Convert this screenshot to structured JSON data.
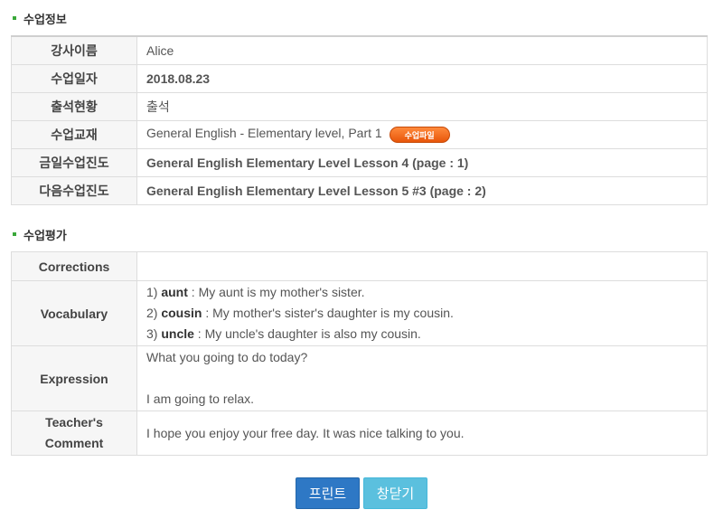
{
  "class_info": {
    "section_title": "수업정보",
    "rows": [
      {
        "label": "강사이름",
        "value": "Alice"
      },
      {
        "label": "수업일자",
        "value": "2018.08.23"
      },
      {
        "label": "출석현황",
        "value": "출석"
      },
      {
        "label": "수업교재",
        "value": "General English - Elementary level, Part 1",
        "button": "수업파일"
      },
      {
        "label": "금일수업진도",
        "value": "General English Elementary Level Lesson 4 (page : 1)"
      },
      {
        "label": "다음수업진도",
        "value": "General English Elementary Level Lesson 5 #3 (page : 2)"
      }
    ]
  },
  "evaluation": {
    "section_title": "수업평가",
    "corrections": {
      "label": "Corrections",
      "value": ""
    },
    "vocabulary": {
      "label": "Vocabulary",
      "items": [
        {
          "num": "1)",
          "word": "aunt",
          "sentence": " : My aunt is my mother's sister."
        },
        {
          "num": "2)",
          "word": "cousin",
          "sentence": " : My mother's sister's daughter is my cousin."
        },
        {
          "num": "3)",
          "word": "uncle",
          "sentence": " : My uncle's daughter is also my cousin."
        }
      ]
    },
    "expression": {
      "label": "Expression",
      "line1": "What you going to do today?",
      "line2": "I am going to relax."
    },
    "comment": {
      "label_line1": "Teacher's",
      "label_line2": "Comment",
      "value": "I hope you enjoy your free day. It was nice talking to you."
    }
  },
  "buttons": {
    "print": "프린트",
    "close": "창닫기"
  }
}
